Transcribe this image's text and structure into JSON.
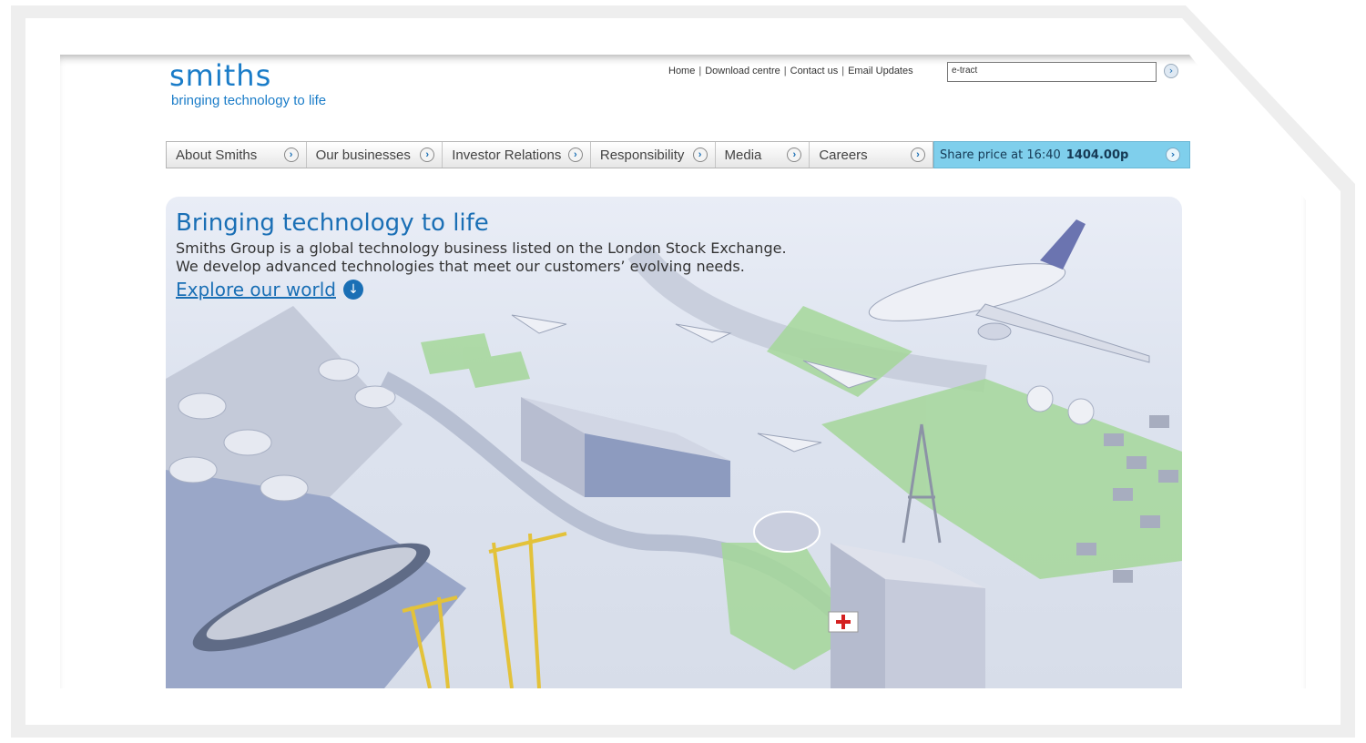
{
  "brand": {
    "logo": "smiths",
    "tagline": "bringing technology to life",
    "brand_color": "#1a7cc8"
  },
  "top_links": {
    "home": "Home",
    "download": "Download centre",
    "contact": "Contact us",
    "email": "Email Updates"
  },
  "search": {
    "value": "e-tract",
    "go_icon": "chevron-right-icon"
  },
  "nav": {
    "items": [
      {
        "label": "About Smiths"
      },
      {
        "label": "Our businesses"
      },
      {
        "label": "Investor Relations"
      },
      {
        "label": "Responsibility"
      },
      {
        "label": "Media"
      },
      {
        "label": "Careers"
      }
    ]
  },
  "share": {
    "label": "Share price at 16:40",
    "value": "1404.00p",
    "color": "#7fcfec"
  },
  "hero": {
    "title": "Bringing technology to life",
    "line1": "Smiths Group is a global technology business listed on the London Stock Exchange.",
    "line2": "We develop advanced technologies that meet our customers’ evolving needs.",
    "link": "Explore our world",
    "link_icon": "arrow-down-icon"
  }
}
